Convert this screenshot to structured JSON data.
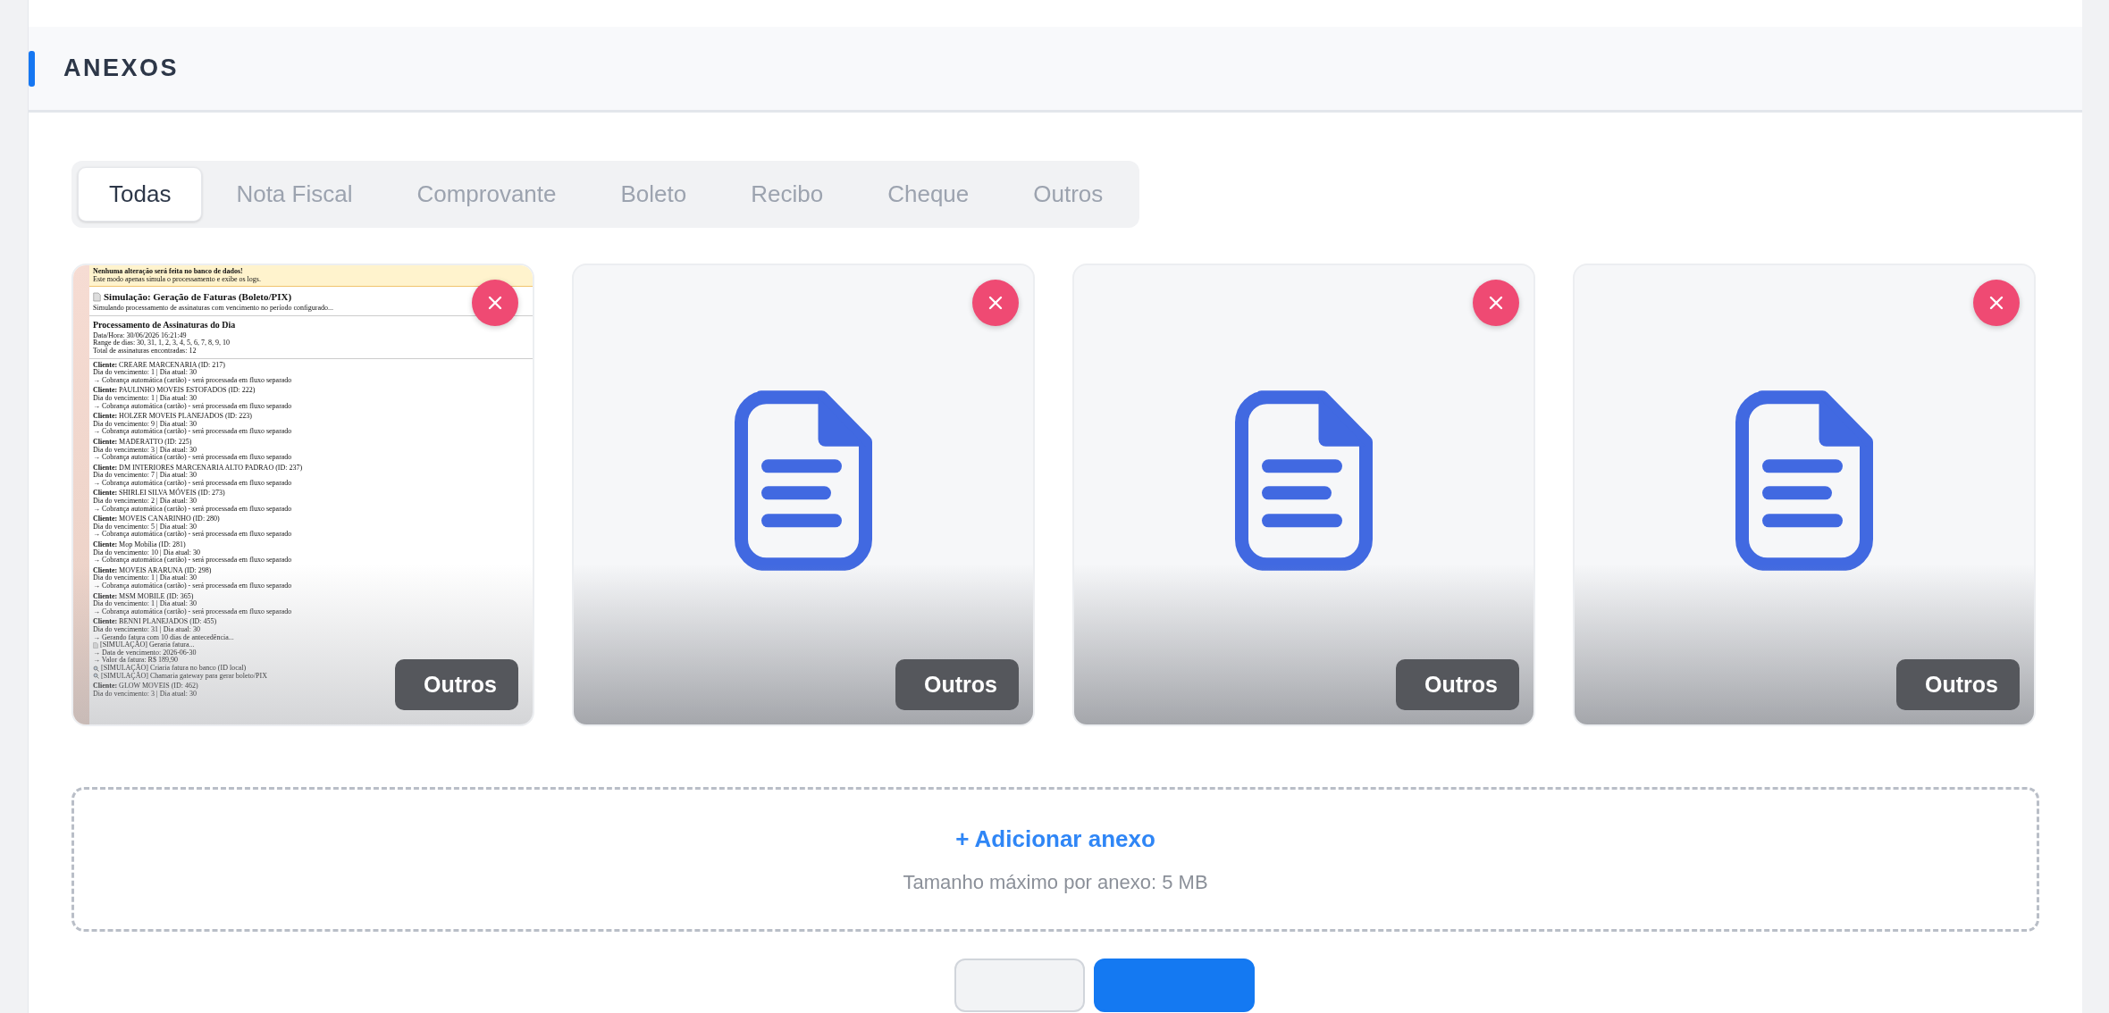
{
  "section": {
    "title": "ANEXOS"
  },
  "tabs": [
    {
      "label": "Todas",
      "selected": true
    },
    {
      "label": "Nota Fiscal",
      "selected": false
    },
    {
      "label": "Comprovante",
      "selected": false
    },
    {
      "label": "Boleto",
      "selected": false
    },
    {
      "label": "Recibo",
      "selected": false
    },
    {
      "label": "Cheque",
      "selected": false
    },
    {
      "label": "Outros",
      "selected": false
    }
  ],
  "attachments": [
    {
      "kind": "preview",
      "tag": "Outros",
      "document": {
        "banner": {
          "title": "Nenhuma alteração será feita no banco de dados!",
          "text": "Este modo apenas simula o processamento e exibe os logs."
        },
        "title": "Simulação: Geração de Faturas (Boleto/PIX)",
        "intro": "Simulando processamento de assinaturas com vencimento no período configurado...",
        "heading": "Processamento de Assinaturas do Dia",
        "meta": [
          "Data/Hora: 30/06/2026 16:21:49",
          "Range de dias: 30, 31, 1, 2, 3, 4, 5, 6, 7, 8, 9, 10",
          "Total de assinaturas encontradas: 12"
        ],
        "clients": [
          {
            "client": "**Cliente:** CREARE MARCENARIA (ID: 217)",
            "lines": [
              {
                "kind": "text",
                "text": "Dia do vencimento: 1 | Dia atual: 30"
              },
              {
                "kind": "text",
                "text": "→ Cobrança automática (cartão) - será processada em fluxo separado"
              }
            ]
          },
          {
            "client": "**Cliente:** PAULINHO MOVEIS ESTOFADOS (ID: 222)",
            "lines": [
              {
                "kind": "text",
                "text": "Dia do vencimento: 1 | Dia atual: 30"
              },
              {
                "kind": "text",
                "text": "→ Cobrança automática (cartão) - será processada em fluxo separado"
              }
            ]
          },
          {
            "client": "**Cliente:** HOLZER MOVEIS PLANEJADOS (ID: 223)",
            "lines": [
              {
                "kind": "text",
                "text": "Dia do vencimento: 9 | Dia atual: 30"
              },
              {
                "kind": "text",
                "text": "→ Cobrança automática (cartão) - será processada em fluxo separado"
              }
            ]
          },
          {
            "client": "**Cliente:** MADERATTO (ID: 225)",
            "lines": [
              {
                "kind": "text",
                "text": "Dia do vencimento: 3 | Dia atual: 30"
              },
              {
                "kind": "text",
                "text": "→ Cobrança automática (cartão) - será processada em fluxo separado"
              }
            ]
          },
          {
            "client": "**Cliente:** DM INTERIORES MARCENARIA ALTO PADRAO (ID: 237)",
            "lines": [
              {
                "kind": "text",
                "text": "Dia do vencimento: 7 | Dia atual: 30"
              },
              {
                "kind": "text",
                "text": "→ Cobrança automática (cartão) - será processada em fluxo separado"
              }
            ]
          },
          {
            "client": "**Cliente:** SHIRLEI SILVA MÓVEIS (ID: 273)",
            "lines": [
              {
                "kind": "text",
                "text": "Dia do vencimento: 2 | Dia atual: 30"
              },
              {
                "kind": "text",
                "text": "→ Cobrança automática (cartão) - será processada em fluxo separado"
              }
            ]
          },
          {
            "client": "**Cliente:** MOVEIS CANARINHO (ID: 280)",
            "lines": [
              {
                "kind": "text",
                "text": "Dia do vencimento: 5 | Dia atual: 30"
              },
              {
                "kind": "text",
                "text": "→ Cobrança automática (cartão) - será processada em fluxo separado"
              }
            ]
          },
          {
            "client": "**Cliente:** Mop Mobília (ID: 281)",
            "lines": [
              {
                "kind": "text",
                "text": "Dia do vencimento: 10 | Dia atual: 30"
              },
              {
                "kind": "text",
                "text": "→ Cobrança automática (cartão) - será processada em fluxo separado"
              }
            ]
          },
          {
            "client": "**Cliente:** MOVEIS ARARUNA (ID: 298)",
            "lines": [
              {
                "kind": "text",
                "text": "Dia do vencimento: 1 | Dia atual: 30"
              },
              {
                "kind": "text",
                "text": "→ Cobrança automática (cartão) - será processada em fluxo separado"
              }
            ]
          },
          {
            "client": "**Cliente:** MSM MOBILE (ID: 365)",
            "lines": [
              {
                "kind": "text",
                "text": "Dia do vencimento: 1 | Dia atual: 30"
              },
              {
                "kind": "text",
                "text": "→ Cobrança automática (cartão) - será processada em fluxo separado"
              }
            ]
          },
          {
            "client": "**Cliente:** BENNI PLANEJADOS (ID: 455)",
            "lines": [
              {
                "kind": "text",
                "text": "Dia do vencimento: 31 | Dia atual: 30"
              },
              {
                "kind": "text",
                "text": "→ Gerando fatura com 10 dias de antecedência..."
              },
              {
                "kind": "doc",
                "text": "[SIMULAÇÃO] Geraria fatura..."
              },
              {
                "kind": "text",
                "text": "→ Data de vencimento: 2026-06-30"
              },
              {
                "kind": "text",
                "text": "→ Valor da fatura: R$ 189,90"
              },
              {
                "kind": "search",
                "text": "[SIMULAÇÃO] Criaria fatura no banco (ID local)"
              },
              {
                "kind": "search",
                "text": "[SIMULAÇÃO] Chamaria gateway para gerar boleto/PIX"
              }
            ]
          },
          {
            "client": "**Cliente:** GLOW MOVEIS (ID: 462)",
            "lines": [
              {
                "kind": "text",
                "text": "Dia do vencimento: 3 | Dia atual: 30"
              }
            ]
          }
        ]
      }
    },
    {
      "kind": "file",
      "tag": "Outros"
    },
    {
      "kind": "file",
      "tag": "Outros"
    },
    {
      "kind": "file",
      "tag": "Outros"
    }
  ],
  "upload": {
    "action": "+ Adicionar anexo",
    "hint": "Tamanho máximo por anexo: 5 MB"
  },
  "footer_buttons": [
    {
      "kind": "secondary"
    },
    {
      "kind": "primary"
    }
  ]
}
